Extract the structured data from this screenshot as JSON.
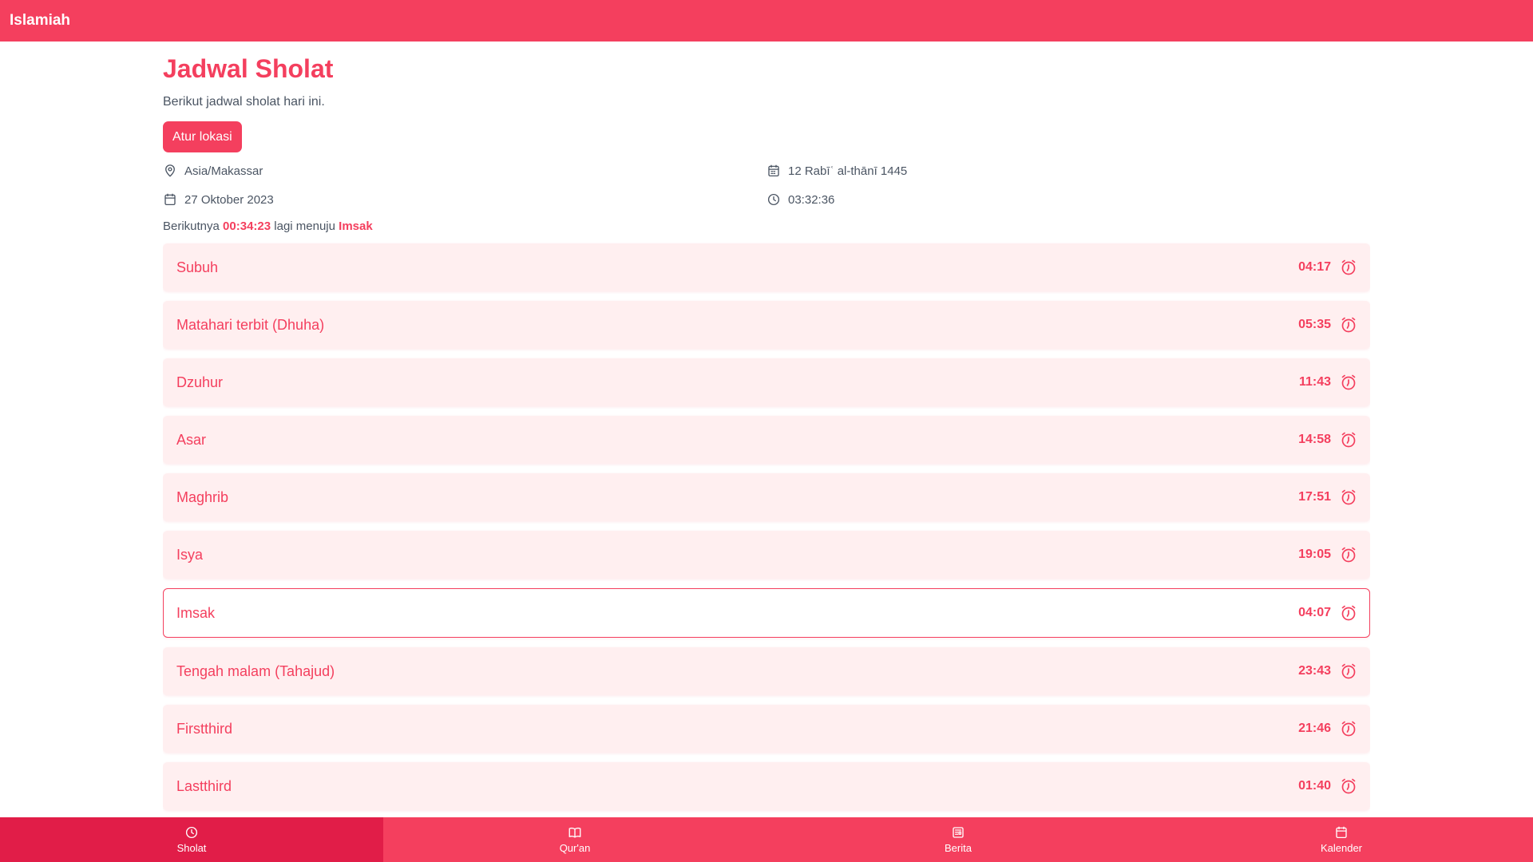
{
  "app": {
    "brand": "Islamiah",
    "accent_color": "#f43f5e",
    "active_nav_color": "#e11d48",
    "row_bg_color": "#ffeff0"
  },
  "header": {
    "title": "Jadwal Sholat",
    "subtitle": "Berikut jadwal sholat hari ini.",
    "set_location_label": "Atur lokasi"
  },
  "info": {
    "location": "Asia/Makassar",
    "location_icon": "map-pin-icon",
    "hijri_date": "12 Rabīʿ al-thānī 1445",
    "hijri_icon": "calendar-icon",
    "gregorian_date": "27 Oktober 2023",
    "gregorian_icon": "calendar-icon",
    "current_time": "03:32:36",
    "time_icon": "clock-icon"
  },
  "countdown": {
    "prefix": "Berikutnya",
    "remaining": "00:34:23",
    "middle": "lagi menuju",
    "next_prayer": "Imsak"
  },
  "prayers": [
    {
      "name": "Subuh",
      "time": "04:17",
      "icon": "alarm-clock-icon"
    },
    {
      "name": "Matahari terbit (Dhuha)",
      "time": "05:35",
      "icon": "alarm-clock-icon"
    },
    {
      "name": "Dzuhur",
      "time": "11:43",
      "icon": "alarm-clock-icon"
    },
    {
      "name": "Asar",
      "time": "14:58",
      "icon": "alarm-clock-icon"
    },
    {
      "name": "Maghrib",
      "time": "17:51",
      "icon": "alarm-clock-icon"
    },
    {
      "name": "Isya",
      "time": "19:05",
      "icon": "alarm-clock-icon"
    },
    {
      "name": "Imsak",
      "time": "04:07",
      "icon": "alarm-clock-icon",
      "active": true
    },
    {
      "name": "Tengah malam (Tahajud)",
      "time": "23:43",
      "icon": "alarm-clock-icon"
    },
    {
      "name": "Firstthird",
      "time": "21:46",
      "icon": "alarm-clock-icon"
    },
    {
      "name": "Lastthird",
      "time": "01:40",
      "icon": "alarm-clock-icon"
    }
  ],
  "bottom_nav": [
    {
      "label": "Sholat",
      "icon": "clock-icon",
      "active": true
    },
    {
      "label": "Qur'an",
      "icon": "book-open-icon"
    },
    {
      "label": "Berita",
      "icon": "newspaper-icon"
    },
    {
      "label": "Kalender",
      "icon": "calendar-icon"
    }
  ]
}
